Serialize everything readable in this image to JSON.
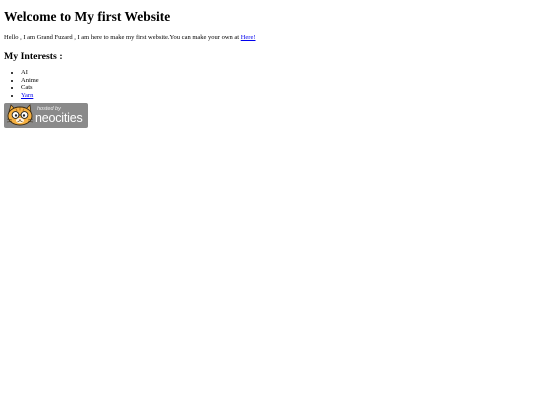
{
  "header": {
    "title": "Welcome to My first Website"
  },
  "intro": {
    "text": "Hello , I am Grand Fuzard , I am here to make my first website.You can make your own at ",
    "link_label": "Here!"
  },
  "interests": {
    "heading": "My Interests :",
    "items": [
      {
        "label": "AI",
        "is_link": false
      },
      {
        "label": "Anime",
        "is_link": false
      },
      {
        "label": "Cats",
        "is_link": false
      },
      {
        "label": "Yarn",
        "is_link": true
      }
    ]
  },
  "badge": {
    "hosted_text": "hosted by",
    "brand_text": "neocities",
    "icon": "neocities-cat-logo-icon",
    "colors": {
      "background": "#8a8a8a",
      "cat_fur": "#f5b041"
    }
  },
  "colors": {
    "link": "#0000ee",
    "text": "#000000",
    "background": "#ffffff"
  }
}
